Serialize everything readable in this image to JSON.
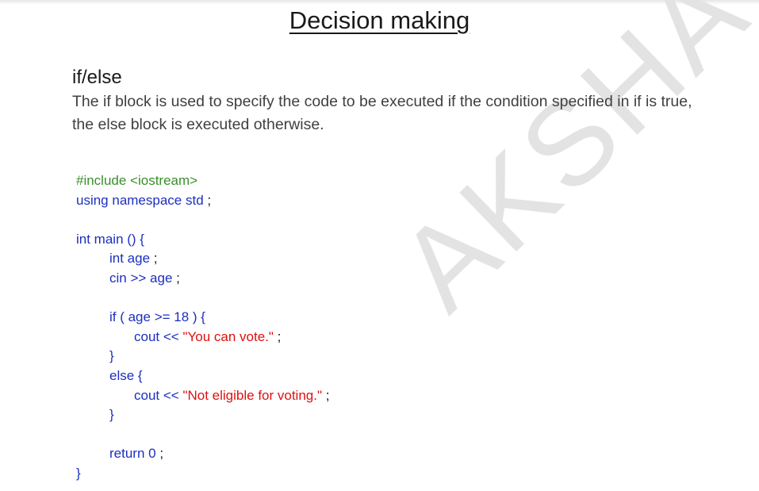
{
  "title": "Decision making",
  "heading": "if/else",
  "description": "The if block is used to specify the code to be executed if the condition specified in if is true, the else block is executed otherwise.",
  "watermark": "AKSHA",
  "code": {
    "include": "#include <iostream>",
    "using": "using namespace std",
    "main_sig": "int main () {",
    "decl_kw": "int age",
    "cin": "cin >> age",
    "if_open": "if ( age >= 18 ) {",
    "cout1": "cout <<",
    "cout1_str": "\"You can vote.\"",
    "close1": "}",
    "else_open": "else {",
    "cout2": "cout <<",
    "cout2_str": "\"Not eligible for voting.\"",
    "close2": "}",
    "ret": "return 0",
    "close_main": "}"
  },
  "colors": {
    "preprocessor": "#3a8f2a",
    "keyword": "#1c2fbf",
    "string": "#e01010"
  }
}
